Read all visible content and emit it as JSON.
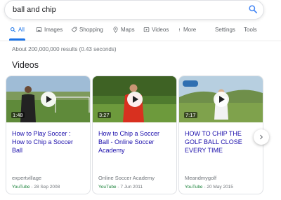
{
  "search": {
    "query": "ball and chip"
  },
  "tabs": [
    {
      "label": "All",
      "icon": "search-icon",
      "active": true
    },
    {
      "label": "Images",
      "icon": "image-icon"
    },
    {
      "label": "Shopping",
      "icon": "tag-icon"
    },
    {
      "label": "Maps",
      "icon": "map-pin-icon"
    },
    {
      "label": "Videos",
      "icon": "play-icon"
    },
    {
      "label": "More",
      "icon": "more-vert-icon"
    },
    {
      "label": "Settings"
    },
    {
      "label": "Tools"
    }
  ],
  "result_stats": "About 200,000,000 results (0.43 seconds)",
  "videos": {
    "title": "Videos",
    "cards": [
      {
        "title": "How to Play Soccer : How to Chip a Soccer Ball",
        "duration": "1:48",
        "channel": "expertvillage",
        "source": "YouTube",
        "date": "28 Sep 2008"
      },
      {
        "title": "How to Chip a Soccer Ball - Online Soccer Academy",
        "duration": "3:27",
        "channel": "Online Soccer Academy",
        "source": "YouTube",
        "date": "7 Jun 2011"
      },
      {
        "title": "HOW TO CHIP THE GOLF BALL CLOSE EVERY TIME",
        "duration": "7:17",
        "channel": "Meandmygolf",
        "source": "YouTube",
        "date": "20 May 2015"
      }
    ]
  },
  "colors": {
    "link": "#1a0dab",
    "accent": "#1a73e8",
    "source_green": "#188038",
    "muted": "#70757a"
  }
}
